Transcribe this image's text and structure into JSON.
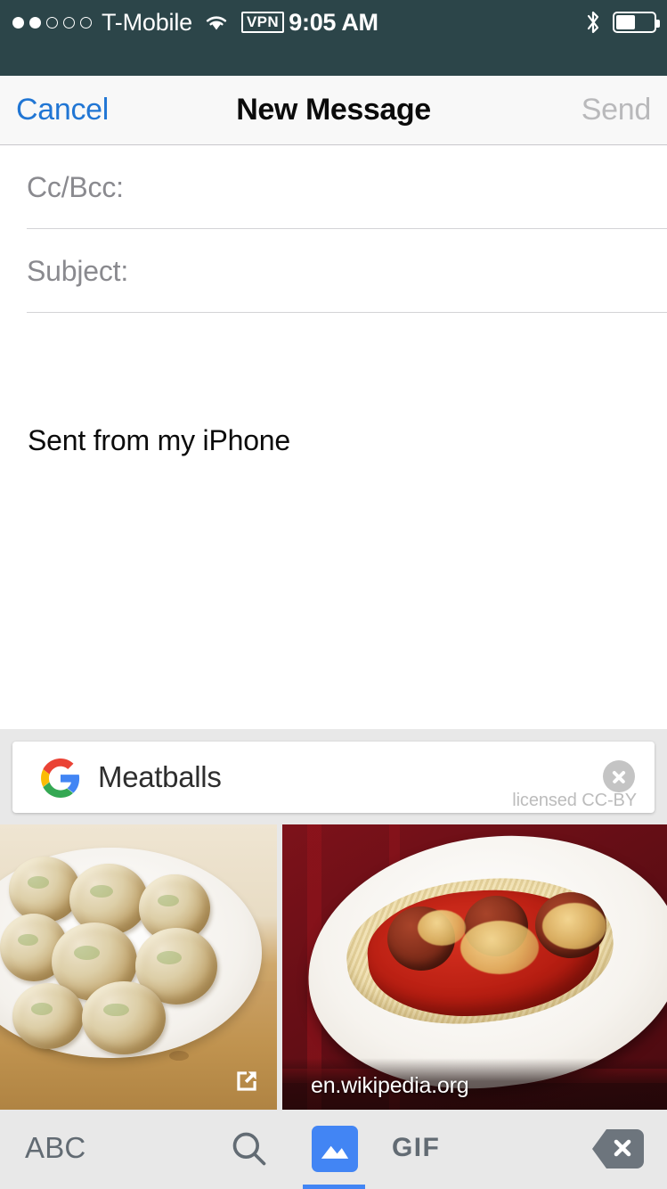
{
  "status_bar": {
    "signal_dots_filled": 2,
    "signal_dots_total": 5,
    "carrier": "T-Mobile",
    "wifi_icon": "wifi-icon",
    "vpn_badge": "VPN",
    "time": "9:05 AM",
    "bluetooth_icon": "bluetooth-icon",
    "battery_level_percent": 47,
    "background_color": "#2c4549"
  },
  "nav_bar": {
    "cancel_label": "Cancel",
    "title": "New Message",
    "send_label": "Send",
    "cancel_color": "#2176d4",
    "send_color": "#b9b9bb"
  },
  "compose": {
    "cc_bcc_placeholder": "Cc/Bcc:",
    "cc_bcc_value": "",
    "subject_placeholder": "Subject:",
    "subject_value": "",
    "body_text": "Sent from my iPhone"
  },
  "search_panel": {
    "logo_icon": "google-g-icon",
    "query": "Meatballs",
    "clear_icon": "clear-circle-x-icon",
    "license_note": "licensed CC-BY",
    "results": [
      {
        "alt": "Plate of baked meatballs on a wooden board",
        "badge_icon": "external-link-icon",
        "source": ""
      },
      {
        "alt": "Spaghetti with meatballs and tomato sauce on a white plate",
        "badge_icon": "",
        "source": "en.wikipedia.org"
      }
    ]
  },
  "toolbar": {
    "abc_label": "ABC",
    "search_icon": "search-icon",
    "image_icon": "image-icon",
    "gif_label": "GIF",
    "backspace_icon": "backspace-icon",
    "active_tab": "image",
    "accent_color": "#4285f4"
  }
}
